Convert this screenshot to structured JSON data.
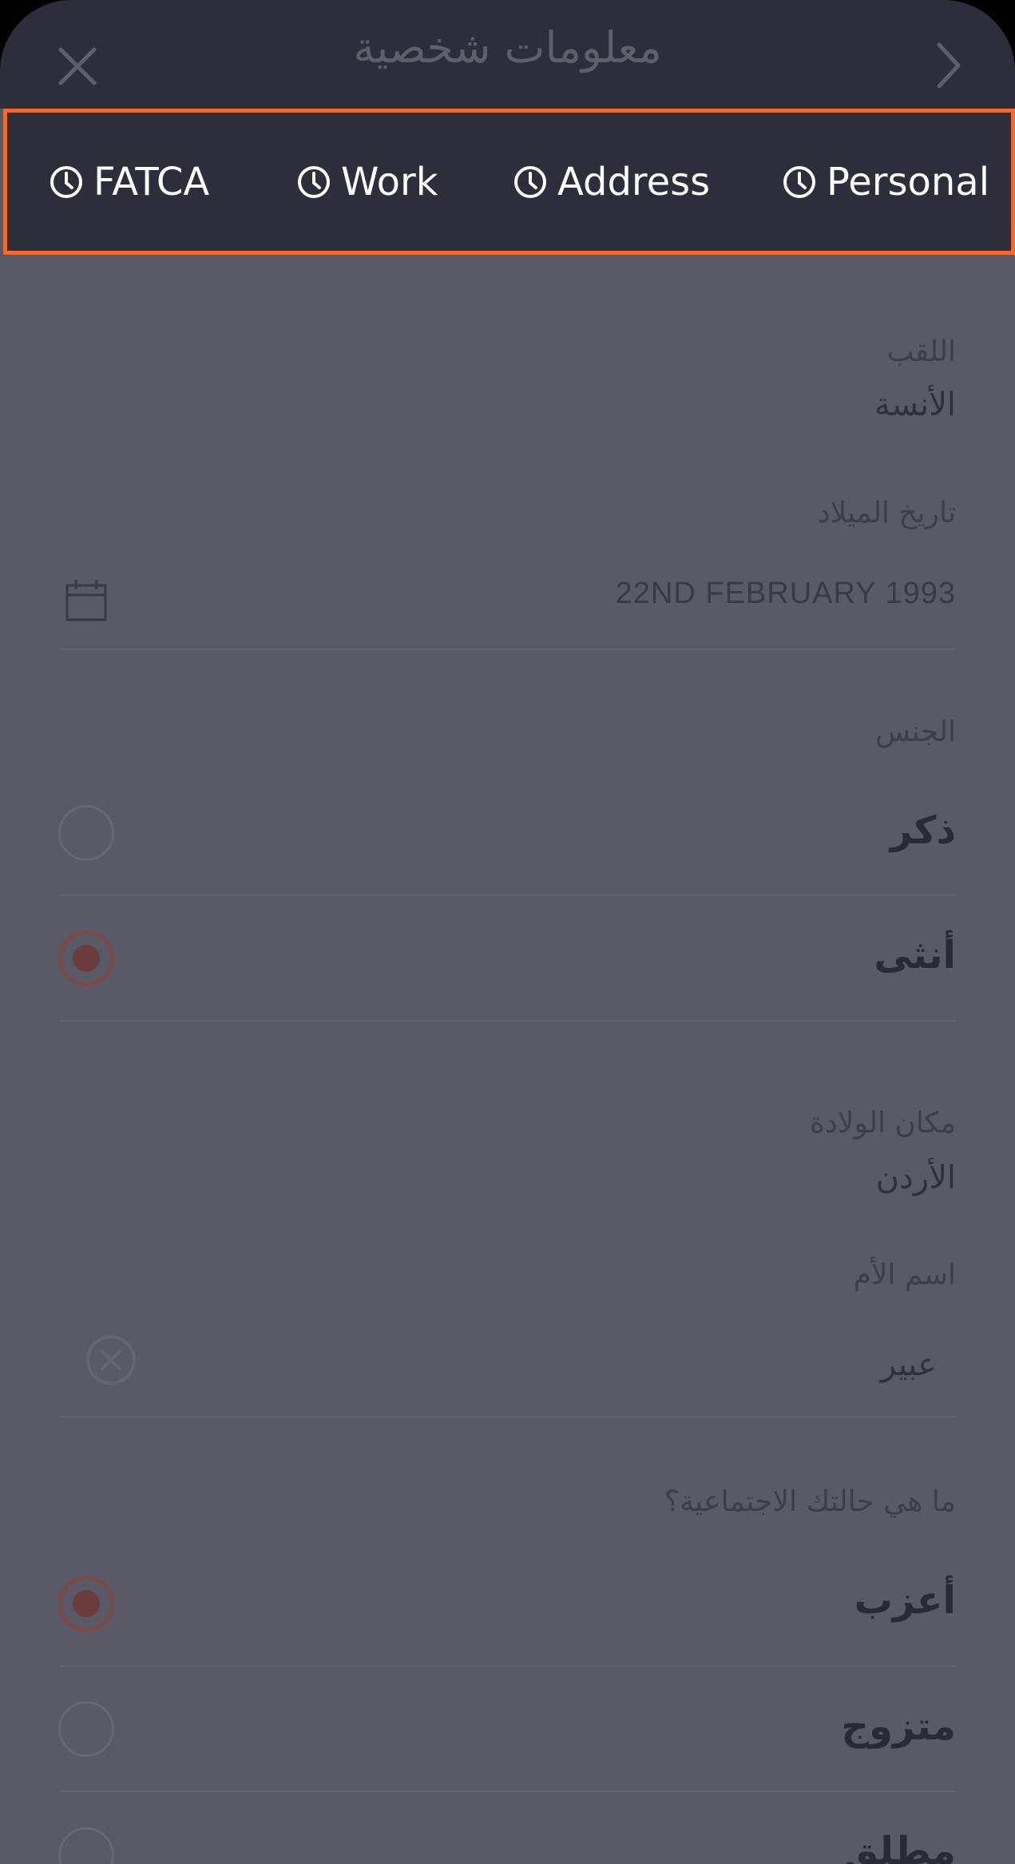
{
  "header": {
    "title": "معلومات شخصية"
  },
  "tabs": [
    {
      "label": "FATCA",
      "icon": "clock-icon"
    },
    {
      "label": "Work",
      "icon": "clock-icon"
    },
    {
      "label": "Address",
      "icon": "clock-icon"
    },
    {
      "label": "Personal",
      "icon": "clock-icon"
    }
  ],
  "form": {
    "title_field": {
      "label": "اللقب",
      "value": "الأنسة"
    },
    "dob_field": {
      "label": "تاريخ الميلاد",
      "value": "22ND FEBRUARY 1993",
      "icon": "calendar-icon"
    },
    "gender": {
      "label": "الجنس",
      "options": [
        {
          "label": "ذكر",
          "selected": false
        },
        {
          "label": "أنثى",
          "selected": true
        }
      ]
    },
    "birthplace_field": {
      "label": "مكان الولادة",
      "value": "الأردن"
    },
    "mother_name_field": {
      "label": "اسم الأم",
      "value": "عبير",
      "icon": "clear-icon"
    },
    "marital_status": {
      "label": "ما هي حالتك الاجتماعية؟",
      "options": [
        {
          "label": "أعزب",
          "selected": true
        },
        {
          "label": "متزوج",
          "selected": false
        },
        {
          "label": "مطلق",
          "selected": false
        }
      ]
    }
  },
  "colors": {
    "accent": "#f26a2d",
    "header_bg": "#2d2d3b",
    "overlay_bg": "#5a5a66"
  }
}
